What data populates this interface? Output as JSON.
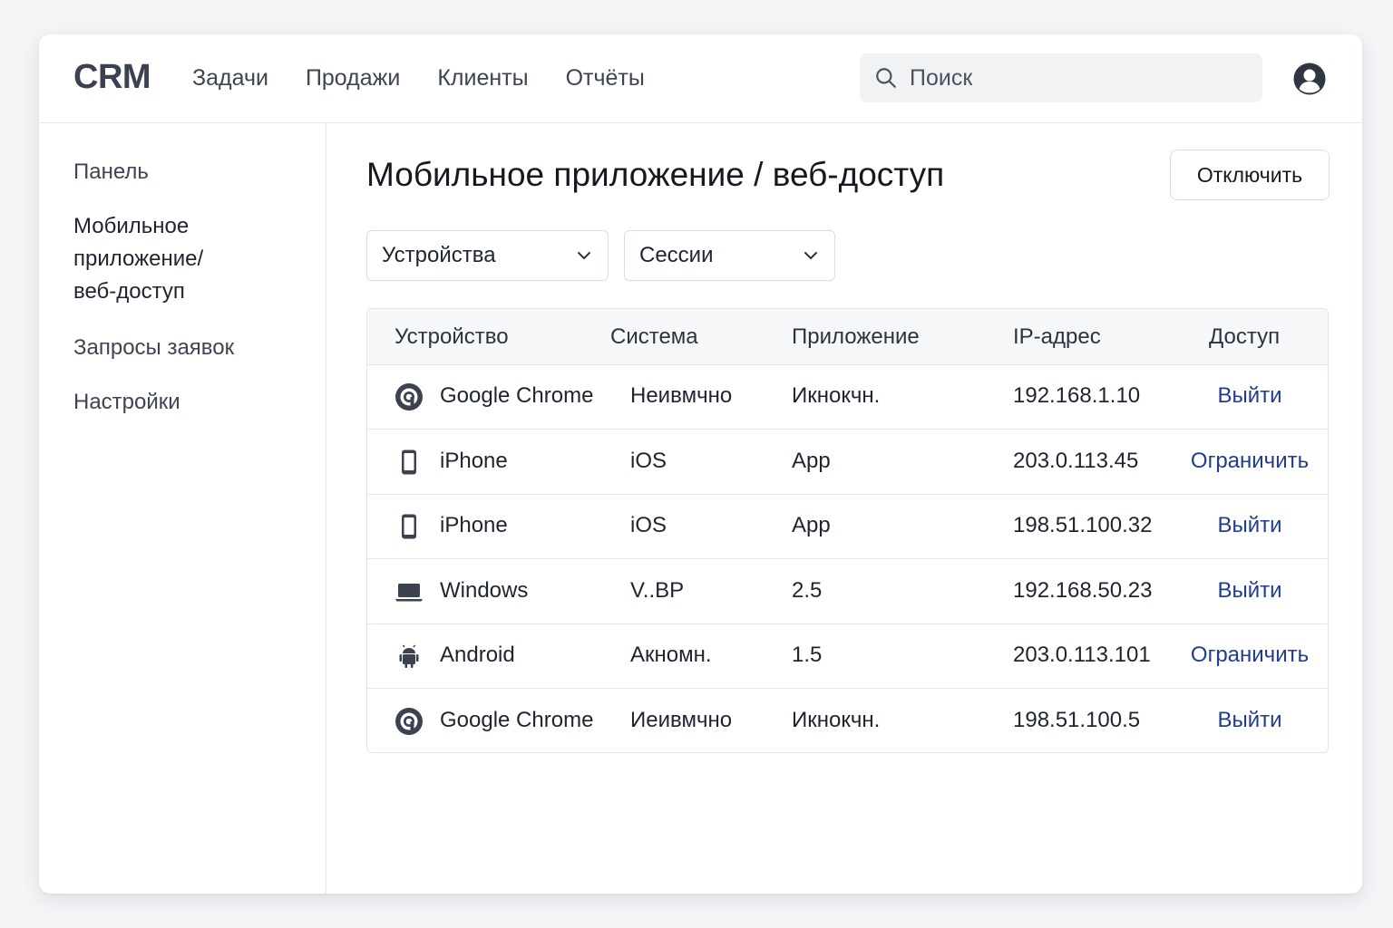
{
  "app": {
    "logo": "CRM",
    "nav": [
      "Задачи",
      "Продажи",
      "Клиенты",
      "Отчёты"
    ],
    "search_placeholder": "Поиск"
  },
  "sidebar": {
    "items": [
      {
        "label": "Панель"
      },
      {
        "label": "Мобильное приложение/ веб-доступ"
      },
      {
        "label": "Запросы заявок"
      },
      {
        "label": "Настройки"
      }
    ]
  },
  "main": {
    "title": "Мобильное приложение / веб-доступ",
    "disable_button": "Отключить",
    "filters": [
      {
        "label": "Устройства"
      },
      {
        "label": "Сессии"
      }
    ],
    "table": {
      "headers": [
        "Устройство",
        "Система",
        "Приложение",
        "IP-адрес",
        "Доступ"
      ],
      "rows": [
        {
          "icon": "chrome-icon",
          "device": "Google Chrome",
          "system": "Неивмчно",
          "app": "Икнокчн.",
          "ip": "192.168.1.10",
          "action": "Выйти"
        },
        {
          "icon": "phone-icon",
          "device": "iPhone",
          "system": "iOS",
          "app": "App",
          "ip": "203.0.113.45",
          "action": "Ограничить"
        },
        {
          "icon": "phone-icon",
          "device": "iPhone",
          "system": "iOS",
          "app": "App",
          "ip": "198.51.100.32",
          "action": "Выйти"
        },
        {
          "icon": "laptop-icon",
          "device": "Windows",
          "system": "V..BP",
          "app": "2.5",
          "ip": "192.168.50.23",
          "action": "Выйти"
        },
        {
          "icon": "android-icon",
          "device": "Android",
          "system": "Акномн.",
          "app": "1.5",
          "ip": "203.0.113.101",
          "action": "Ограничить"
        },
        {
          "icon": "chrome-icon",
          "device": "Google Chrome",
          "system": "Иеивмчно",
          "app": "Икнокчн.",
          "ip": "198.51.100.5",
          "action": "Выйти"
        }
      ]
    }
  }
}
